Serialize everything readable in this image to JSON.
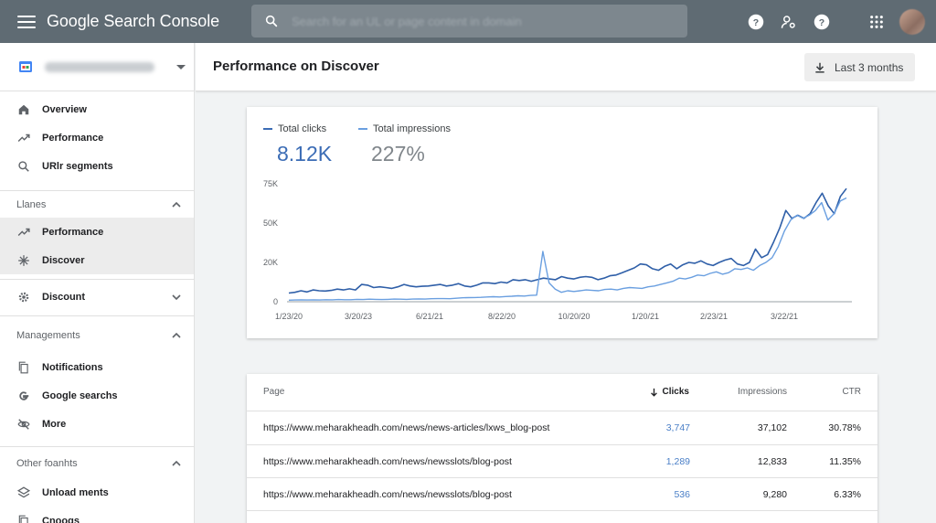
{
  "app": {
    "title": "Google Search Console"
  },
  "search": {
    "placeholder": "Search for an UL or page content in domain"
  },
  "property": {
    "name": "hidden-account-domain"
  },
  "sidebar": {
    "top_items": [
      {
        "label": "Overview",
        "icon": "home-icon"
      },
      {
        "label": "Performance",
        "icon": "trending-up-icon"
      },
      {
        "label": "URlr segments",
        "icon": "search-icon"
      }
    ],
    "section1": {
      "label": "Llanes",
      "items": [
        {
          "label": "Performance",
          "icon": "trending-up-icon",
          "active": true
        },
        {
          "label": "Discover",
          "icon": "asterisk-icon",
          "active": true
        }
      ]
    },
    "discount": {
      "label": "Discount",
      "icon": "gear-icon"
    },
    "section2": {
      "label": "Managements",
      "items": [
        {
          "label": "Notifications",
          "icon": "copy-icon"
        },
        {
          "label": "Google searchs",
          "icon": "google-g-icon"
        },
        {
          "label": "More",
          "icon": "eye-off-icon"
        }
      ]
    },
    "section3": {
      "label": "Other foanhts",
      "items": [
        {
          "label": "Unload ments",
          "icon": "layers-icon"
        },
        {
          "label": "Cnoogs",
          "icon": "copy-icon"
        }
      ]
    }
  },
  "header": {
    "title": "Performance on Discover",
    "range_label": "Last 3 months"
  },
  "metrics": {
    "clicks": {
      "label": "Total clicks",
      "value": "8.12K",
      "color": "#3b6cb5"
    },
    "impressions": {
      "label": "Total impressions",
      "value": "227%",
      "color": "#6a9fe0"
    }
  },
  "chart_data": {
    "type": "line",
    "x": [
      "1/23/20",
      "3/20/23",
      "6/21/21",
      "8/22/20",
      "10/20/20",
      "1/20/21",
      "2/23/21",
      "3/22/21"
    ],
    "yticks": [
      "75K",
      "50K",
      "20K",
      "0"
    ],
    "ylim": [
      0,
      75000
    ],
    "series": [
      {
        "name": "Total clicks",
        "color": "#2f5fa8",
        "values": [
          5500,
          6000,
          7000,
          6200,
          7500,
          7000,
          6800,
          7200,
          8000,
          7500,
          8200,
          7500,
          11000,
          10500,
          9000,
          9500,
          9000,
          8500,
          9500,
          11000,
          10000,
          9500,
          9800,
          10000,
          10500,
          11000,
          10000,
          10500,
          11500,
          10000,
          9500,
          10500,
          12000,
          12000,
          11500,
          12500,
          12000,
          14000,
          13500,
          14000,
          13000,
          14000,
          15000,
          14500,
          14000,
          16000,
          15000,
          14500,
          15500,
          16000,
          15500,
          14000,
          15000,
          16500,
          17000,
          18500,
          20000,
          21500,
          24000,
          23500,
          21000,
          20000,
          22500,
          24000,
          21000,
          23500,
          25000,
          24500,
          26000,
          24000,
          23000,
          25000,
          26500,
          27500,
          24000,
          23000,
          25000,
          33500,
          28000,
          30000,
          38000,
          47000,
          58000,
          53000,
          55000,
          53000,
          56000,
          63000,
          69000,
          61000,
          56000,
          67000,
          72000
        ]
      },
      {
        "name": "Total impressions",
        "color": "#6a9fe0",
        "values": [
          1000,
          1100,
          1200,
          1100,
          1200,
          1100,
          1300,
          1200,
          1400,
          1300,
          1300,
          1500,
          1400,
          1600,
          1500,
          1400,
          1500,
          1700,
          1600,
          1500,
          1700,
          1800,
          1700,
          1900,
          2000,
          2000,
          1900,
          2200,
          2500,
          2600,
          2700,
          2800,
          3000,
          3200,
          3000,
          3300,
          3500,
          3800,
          3600,
          4000,
          4200,
          32000,
          12000,
          8000,
          6000,
          7000,
          6500,
          7000,
          7500,
          7200,
          7000,
          7800,
          8000,
          7500,
          8500,
          9000,
          8800,
          8500,
          9500,
          10000,
          11000,
          12000,
          13000,
          15000,
          14500,
          15500,
          17000,
          16500,
          18000,
          19000,
          17500,
          18500,
          21000,
          20500,
          21500,
          20000,
          23000,
          25000,
          28000,
          35000,
          45000,
          52000,
          55000,
          53000,
          55000,
          58000,
          63000,
          52000,
          56000,
          64000,
          66000
        ]
      }
    ]
  },
  "table": {
    "headers": {
      "page": "Page",
      "clicks": "Clicks",
      "impressions": "Impressions",
      "ctr": "CTR"
    },
    "rows": [
      {
        "page": "https://www.meharakheadh.com/news/news-articles/lxws_blog-post",
        "clicks": "3,747",
        "impressions": "37,102",
        "ctr": "30.78%"
      },
      {
        "page": "https://www.meharakheadh.com/news/newsslots/blog-post",
        "clicks": "1,289",
        "impressions": "12,833",
        "ctr": "11.35%"
      },
      {
        "page": "https://www.meharakheadh.com/news/newsslots/blog-post",
        "clicks": "536",
        "impressions": "9,280",
        "ctr": "6.33%"
      }
    ]
  }
}
